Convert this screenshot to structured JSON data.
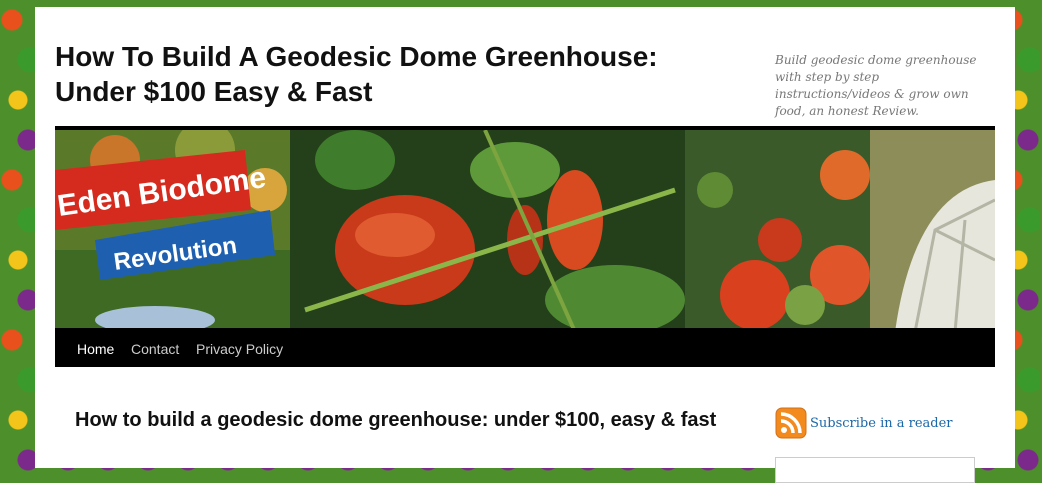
{
  "site": {
    "title_line1": "How To Build A Geodesic Dome Greenhouse:",
    "title_line2": "Under $100 Easy & Fast",
    "tagline": "Build geodesic dome greenhouse with step by step instructions/videos & grow own food, an honest Review."
  },
  "header_image": {
    "banner_line1": "Eden Biodome",
    "banner_line2": "Revolution"
  },
  "nav": {
    "items": [
      {
        "label": "Home",
        "active": true
      },
      {
        "label": "Contact",
        "active": false
      },
      {
        "label": "Privacy Policy",
        "active": false
      }
    ]
  },
  "post": {
    "title": "How to build a geodesic dome greenhouse: under $100, easy & fast"
  },
  "sidebar": {
    "rss_icon": "rss-icon",
    "subscribe_label": "Subscribe in a reader",
    "email_placeholder": ""
  },
  "colors": {
    "nav_bg": "#000000",
    "link": "#1b68a8",
    "rss_orange": "#f28a1e"
  }
}
